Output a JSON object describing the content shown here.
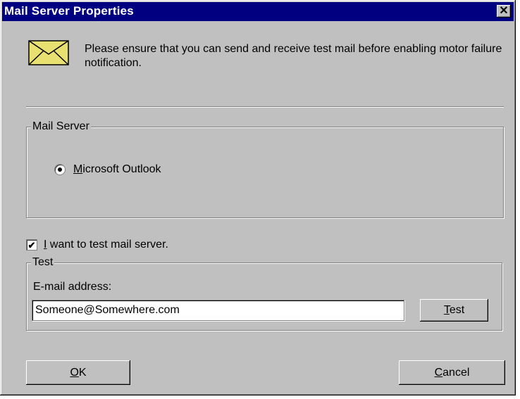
{
  "window": {
    "title": "Mail Server Properties",
    "close_glyph": "✕"
  },
  "notice": {
    "icon": "envelope-icon",
    "text": "Please ensure that you can send and receive test mail before enabling motor failure notification."
  },
  "mail_server_group": {
    "label": "Mail Server",
    "options": [
      {
        "label_first": "M",
        "label_rest": "icrosoft Outlook",
        "selected": true
      }
    ]
  },
  "test_checkbox": {
    "checked": true,
    "label_first": "I",
    "label_rest": " want to test mail server."
  },
  "test_group": {
    "label": "Test",
    "email_label": "E-mail address:",
    "email_value": "Someone@Somewhere.com",
    "test_button_first": "T",
    "test_button_rest": "est"
  },
  "buttons": {
    "ok_first": "O",
    "ok_rest": "K",
    "cancel_first": "C",
    "cancel_rest": "ancel"
  },
  "colors": {
    "face": "#c0c0c0",
    "titlebar": "#000080",
    "envelope": "#e8e070"
  }
}
